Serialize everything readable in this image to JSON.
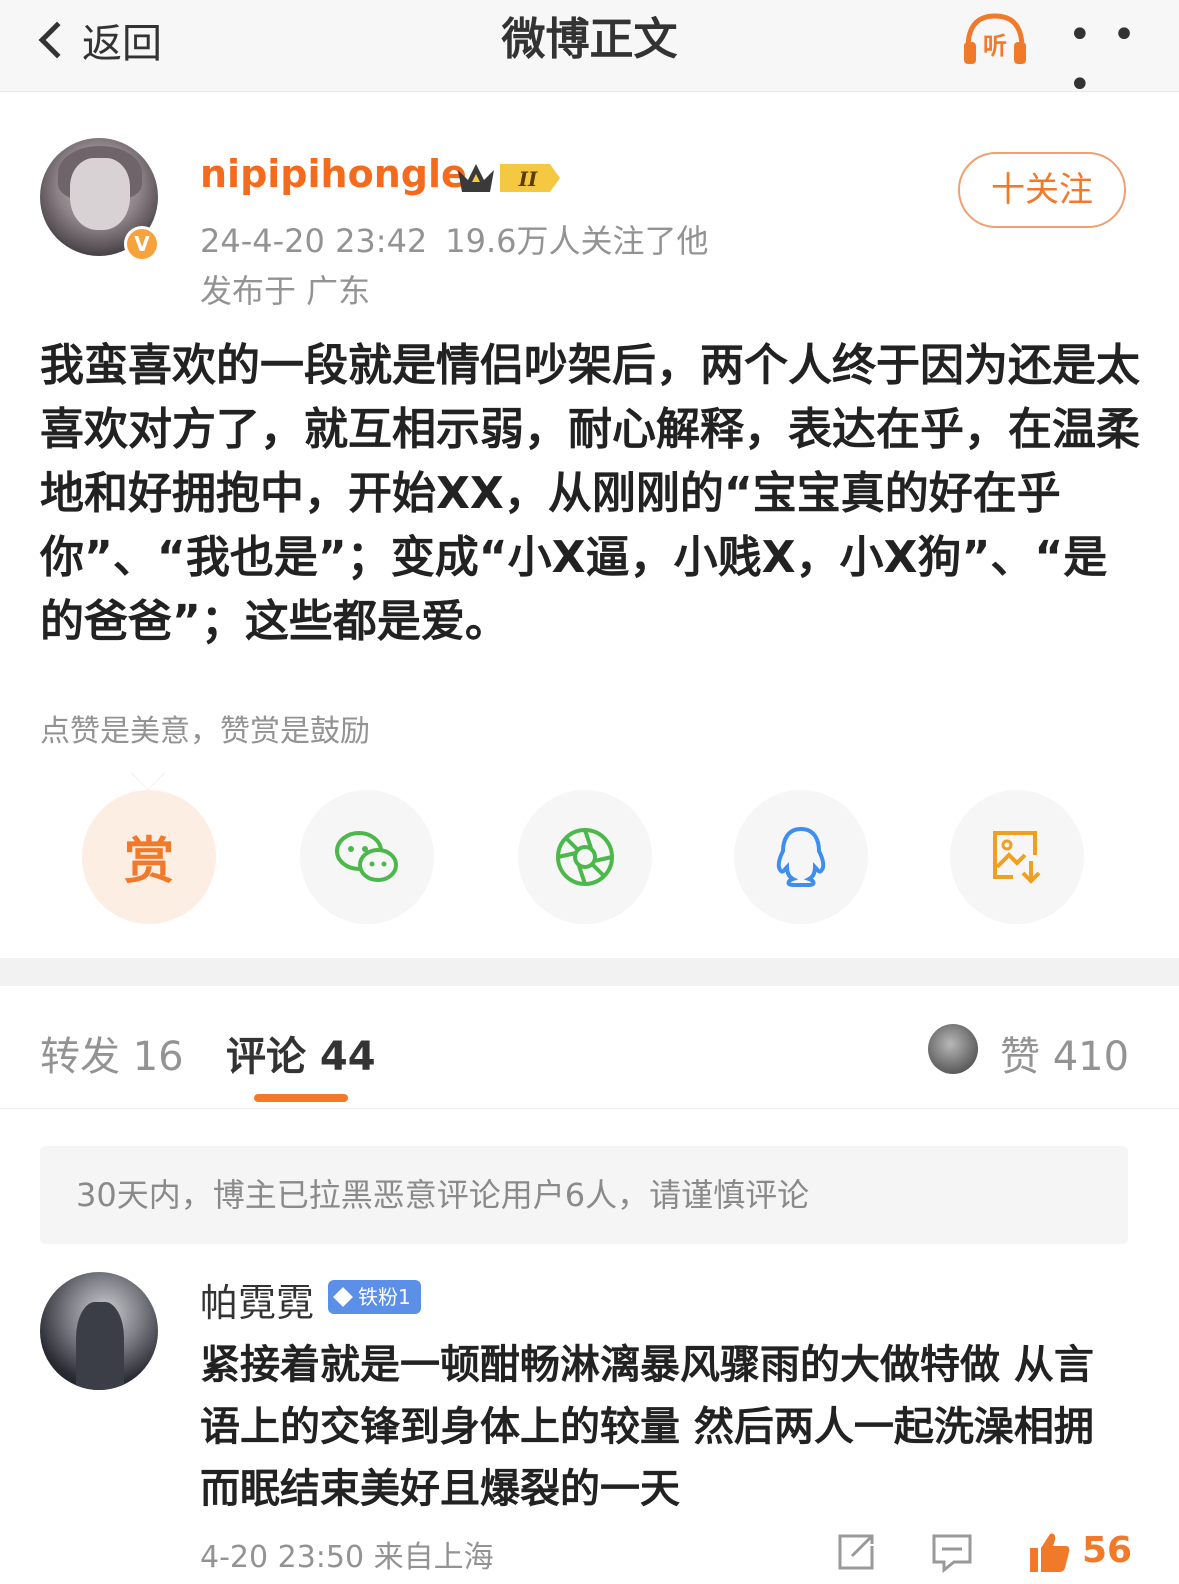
{
  "nav": {
    "back_label": "返回",
    "title": "微博正文",
    "listen_label": "听",
    "more_label": "• • •"
  },
  "author": {
    "name": "nipipihongle",
    "level_badge": "II",
    "verified_badge": "V",
    "timestamp": "24-4-20 23:42",
    "followers": "19.6万人关注了他",
    "location": "发布于 广东",
    "follow_label": "十关注"
  },
  "post": {
    "text": "我蛮喜欢的一段就是情侣吵架后，两个人终于因为还是太喜欢对方了，就互相示弱，耐心解释，表达在乎，在温柔地和好拥抱中，开始XX，从刚刚的“宝宝真的好在乎你”、“我也是”；变成“小X逼，小贱X，小X狗”、“是的爸爸”；这些都是爱。",
    "reward_hint": "点赞是美意，赞赏是鼓励"
  },
  "share": {
    "reward_label": "赏",
    "icons": [
      "wechat-icon",
      "moments-icon",
      "qq-icon",
      "save-image-icon"
    ]
  },
  "tabs": {
    "repost": "转发 16",
    "comments": "评论 44",
    "likes": "赞 410"
  },
  "notice": "30天内，博主已拉黑恶意评论用户6人，请谨慎评论",
  "comment": {
    "name": "帕霓霓",
    "badge": "铁粉1",
    "text": "紧接着就是一顿酣畅淋漓暴风骤雨的大做特做 从言语上的交锋到身体上的较量 然后两人一起洗澡相拥而眠结束美好且爆裂的一天",
    "meta": "4-20 23:50 来自上海",
    "like_count": "56"
  },
  "colors": {
    "accent": "#f07a2a",
    "name_orange": "#f46b1e",
    "muted": "#939393",
    "fan_badge": "#5b8fe8"
  }
}
